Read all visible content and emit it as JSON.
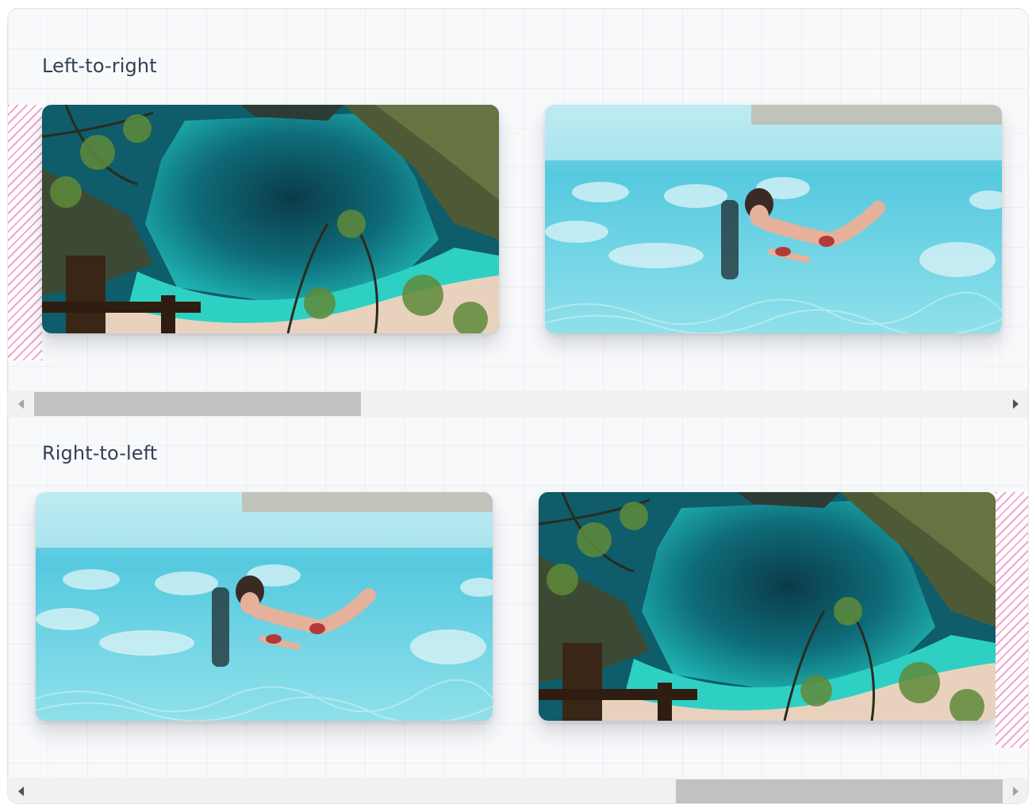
{
  "sections": [
    {
      "label": "Left-to-right",
      "direction": "ltr",
      "scroll_position_fraction": 0.0
    },
    {
      "label": "Right-to-left",
      "direction": "rtl",
      "scroll_position_fraction": 1.0
    }
  ],
  "images": {
    "beach": "aerial view of a turquoise cove with cliffs and sandy beach",
    "underwater": "woman swimming underwater among fish"
  },
  "colors": {
    "frame_background": "#f8f9fb",
    "label_text": "#334155",
    "hatch_pink": "#f1a4cf",
    "scrollbar_track": "#f1f1f1",
    "scrollbar_thumb": "#c1c1c1"
  }
}
